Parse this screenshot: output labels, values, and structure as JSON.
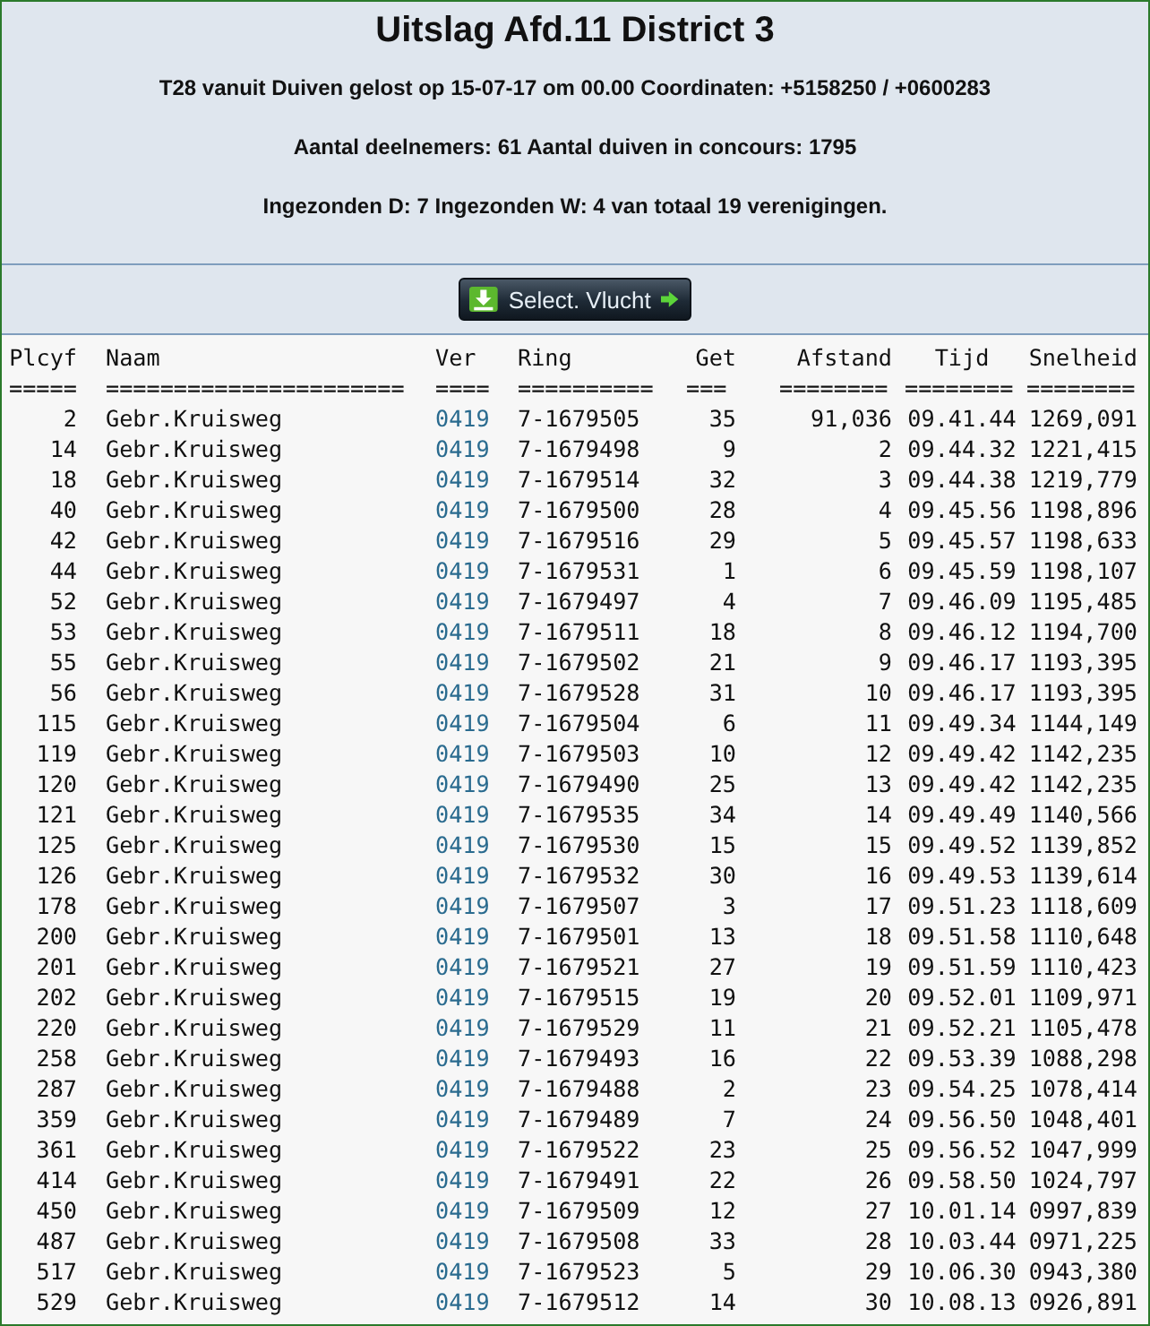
{
  "title": "Uitslag Afd.11 District 3",
  "info_lines": [
    "T28 vanuit Duiven gelost op 15-07-17 om 00.00 Coordinaten: +5158250 / +0600283",
    "Aantal deelnemers: 61 Aantal duiven in concours: 1795",
    "Ingezonden D: 7 Ingezonden W: 4 van totaal 19 verenigingen."
  ],
  "button": {
    "label": "Select. Vlucht"
  },
  "table": {
    "columns": [
      {
        "label": "Plcyf",
        "separator": "=====",
        "kind": "text"
      },
      {
        "label": "Naam",
        "separator": "======================",
        "kind": "text"
      },
      {
        "label": "Ver",
        "separator": "====",
        "kind": "link"
      },
      {
        "label": "Ring",
        "separator": "==========",
        "kind": "text"
      },
      {
        "label": "Get",
        "separator": "===",
        "kind": "text"
      },
      {
        "label": "Afstand",
        "separator": "========",
        "kind": "text"
      },
      {
        "label": "Tijd",
        "separator": "========",
        "kind": "text"
      },
      {
        "label": "Snelheid",
        "separator": "========",
        "kind": "text"
      }
    ],
    "rows": [
      [
        "2",
        "Gebr.Kruisweg",
        "0419",
        "7-1679505",
        "35",
        "91,036",
        "09.41.44",
        "1269,091"
      ],
      [
        "14",
        "Gebr.Kruisweg",
        "0419",
        "7-1679498",
        "9",
        "2",
        "09.44.32",
        "1221,415"
      ],
      [
        "18",
        "Gebr.Kruisweg",
        "0419",
        "7-1679514",
        "32",
        "3",
        "09.44.38",
        "1219,779"
      ],
      [
        "40",
        "Gebr.Kruisweg",
        "0419",
        "7-1679500",
        "28",
        "4",
        "09.45.56",
        "1198,896"
      ],
      [
        "42",
        "Gebr.Kruisweg",
        "0419",
        "7-1679516",
        "29",
        "5",
        "09.45.57",
        "1198,633"
      ],
      [
        "44",
        "Gebr.Kruisweg",
        "0419",
        "7-1679531",
        "1",
        "6",
        "09.45.59",
        "1198,107"
      ],
      [
        "52",
        "Gebr.Kruisweg",
        "0419",
        "7-1679497",
        "4",
        "7",
        "09.46.09",
        "1195,485"
      ],
      [
        "53",
        "Gebr.Kruisweg",
        "0419",
        "7-1679511",
        "18",
        "8",
        "09.46.12",
        "1194,700"
      ],
      [
        "55",
        "Gebr.Kruisweg",
        "0419",
        "7-1679502",
        "21",
        "9",
        "09.46.17",
        "1193,395"
      ],
      [
        "56",
        "Gebr.Kruisweg",
        "0419",
        "7-1679528",
        "31",
        "10",
        "09.46.17",
        "1193,395"
      ],
      [
        "115",
        "Gebr.Kruisweg",
        "0419",
        "7-1679504",
        "6",
        "11",
        "09.49.34",
        "1144,149"
      ],
      [
        "119",
        "Gebr.Kruisweg",
        "0419",
        "7-1679503",
        "10",
        "12",
        "09.49.42",
        "1142,235"
      ],
      [
        "120",
        "Gebr.Kruisweg",
        "0419",
        "7-1679490",
        "25",
        "13",
        "09.49.42",
        "1142,235"
      ],
      [
        "121",
        "Gebr.Kruisweg",
        "0419",
        "7-1679535",
        "34",
        "14",
        "09.49.49",
        "1140,566"
      ],
      [
        "125",
        "Gebr.Kruisweg",
        "0419",
        "7-1679530",
        "15",
        "15",
        "09.49.52",
        "1139,852"
      ],
      [
        "126",
        "Gebr.Kruisweg",
        "0419",
        "7-1679532",
        "30",
        "16",
        "09.49.53",
        "1139,614"
      ],
      [
        "178",
        "Gebr.Kruisweg",
        "0419",
        "7-1679507",
        "3",
        "17",
        "09.51.23",
        "1118,609"
      ],
      [
        "200",
        "Gebr.Kruisweg",
        "0419",
        "7-1679501",
        "13",
        "18",
        "09.51.58",
        "1110,648"
      ],
      [
        "201",
        "Gebr.Kruisweg",
        "0419",
        "7-1679521",
        "27",
        "19",
        "09.51.59",
        "1110,423"
      ],
      [
        "202",
        "Gebr.Kruisweg",
        "0419",
        "7-1679515",
        "19",
        "20",
        "09.52.01",
        "1109,971"
      ],
      [
        "220",
        "Gebr.Kruisweg",
        "0419",
        "7-1679529",
        "11",
        "21",
        "09.52.21",
        "1105,478"
      ],
      [
        "258",
        "Gebr.Kruisweg",
        "0419",
        "7-1679493",
        "16",
        "22",
        "09.53.39",
        "1088,298"
      ],
      [
        "287",
        "Gebr.Kruisweg",
        "0419",
        "7-1679488",
        "2",
        "23",
        "09.54.25",
        "1078,414"
      ],
      [
        "359",
        "Gebr.Kruisweg",
        "0419",
        "7-1679489",
        "7",
        "24",
        "09.56.50",
        "1048,401"
      ],
      [
        "361",
        "Gebr.Kruisweg",
        "0419",
        "7-1679522",
        "23",
        "25",
        "09.56.52",
        "1047,999"
      ],
      [
        "414",
        "Gebr.Kruisweg",
        "0419",
        "7-1679491",
        "22",
        "26",
        "09.58.50",
        "1024,797"
      ],
      [
        "450",
        "Gebr.Kruisweg",
        "0419",
        "7-1679509",
        "12",
        "27",
        "10.01.14",
        "0997,839"
      ],
      [
        "487",
        "Gebr.Kruisweg",
        "0419",
        "7-1679508",
        "33",
        "28",
        "10.03.44",
        "0971,225"
      ],
      [
        "517",
        "Gebr.Kruisweg",
        "0419",
        "7-1679523",
        "5",
        "29",
        "10.06.30",
        "0943,380"
      ],
      [
        "529",
        "Gebr.Kruisweg",
        "0419",
        "7-1679512",
        "14",
        "30",
        "10.08.13",
        "0926,891"
      ]
    ]
  }
}
